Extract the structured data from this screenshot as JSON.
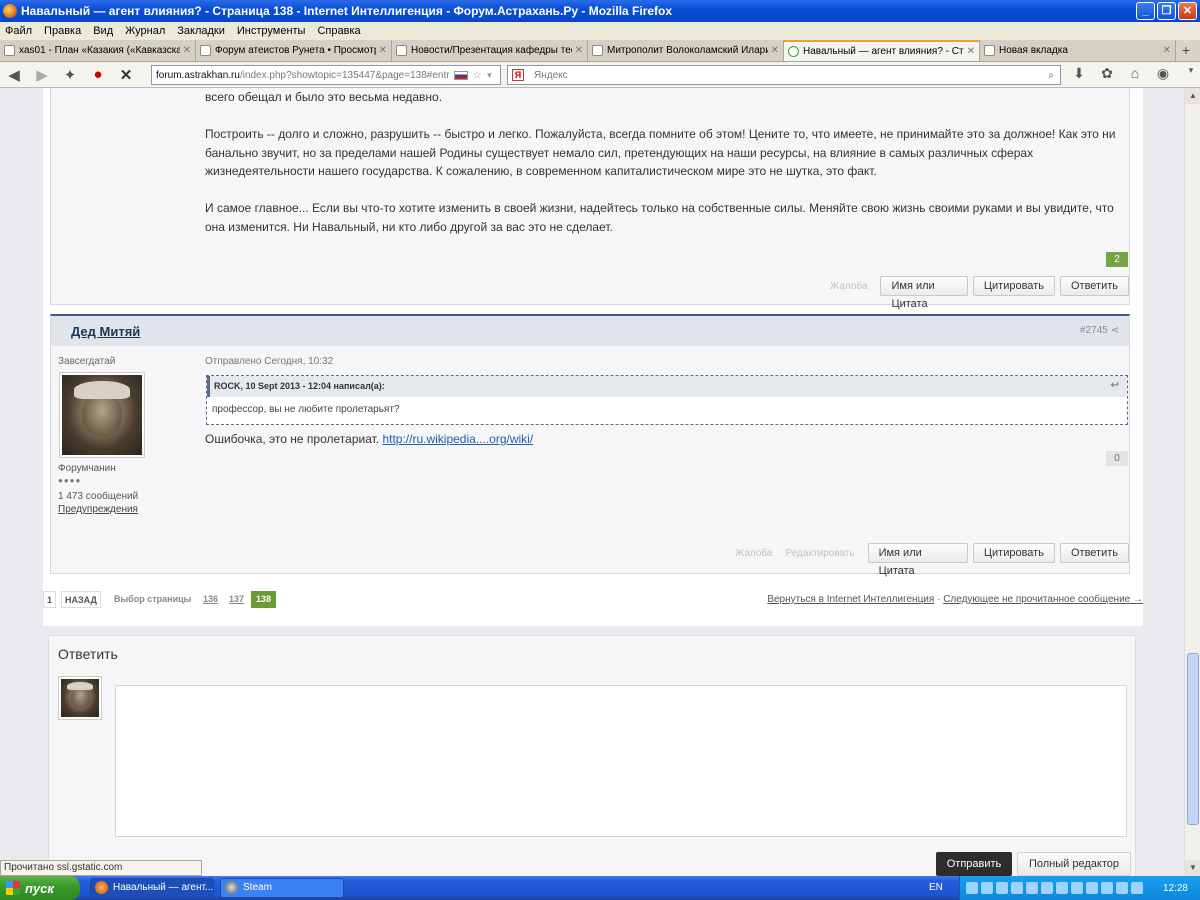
{
  "window": {
    "title": "Навальный — агент влияния? - Страница 138 - Internet Интеллигенция - Форум.Астрахань.Ру - Mozilla Firefox"
  },
  "menu": [
    "Файл",
    "Правка",
    "Вид",
    "Журнал",
    "Закладки",
    "Инструменты",
    "Справка"
  ],
  "tabs": [
    {
      "label": "xas01 - План «Казакия («Кавказска..."
    },
    {
      "label": "Форум атеистов Рунета • Просмотр ..."
    },
    {
      "label": "Новости/Презентация кафедры тео..."
    },
    {
      "label": "Митрополит Волоколамский Иларио..."
    },
    {
      "label": "Навальный — агент влияния? - Стр..."
    },
    {
      "label": "Новая вкладка"
    }
  ],
  "nav": {
    "url_host": "forum.astrakhan.ru",
    "url_path": "/index.php?showtopic=135447&page=138#entr",
    "search_placeholder": "Яндекс"
  },
  "post1": {
    "line0": "всего обещал и было это весьма недавно.",
    "para1": "Построить -- долго и сложно, разрушить -- быстро и легко. Пожалуйста, всегда помните об этом! Цените то, что имеете, не принимайте это за должное! Как это ни банально звучит, но за пределами нашей Родины существует немало сил, претендующих на наши ресурсы, на влияние в самых различных сферах жизнедеятельности нашего государства. К сожалению, в современном капиталистическом мире это не шутка, это факт.",
    "para2": "И самое главное... Если вы что-то хотите изменить в своей жизни, надейтесь только на собственные силы. Меняйте свою жизнь своими руками и вы увидите, что она изменится. Ни Навальный, ни кто либо другой за вас это не сделает.",
    "rep": "2",
    "report": "Жалоба",
    "btn_name_quote": "Имя или Цитата",
    "btn_quote": "Цитировать",
    "btn_reply": "Ответить"
  },
  "post2": {
    "author": "Дед Митяй",
    "number": "#2745",
    "group": "Завсегдатай",
    "rank": "Форумчанин",
    "rank_dots": "●●●●",
    "posts_count": "1 473 сообщений",
    "warnings": "Предупреждения",
    "posted": "Отправлено Сегодня, 10:32",
    "quote_header": "ROCK, 10 Sept 2013 - 12:04 написал(а):",
    "quote_body": "профессор, вы не любите пролетарьят?",
    "text": "Ошибочка, это не пролетариат. ",
    "link": "http://ru.wikipedia....org/wiki/",
    "rep": "0",
    "report": "Жалоба",
    "edit": "Редактировать",
    "btn_name_quote": "Имя или Цитата",
    "btn_quote": "Цитировать",
    "btn_reply": "Ответить"
  },
  "pager": {
    "first": "1",
    "back": "НАЗАД",
    "choose": "Выбор страницы",
    "p136": "136",
    "p137": "137",
    "current": "138",
    "return_link": "Вернуться в Internet Интеллигенция",
    "sep": " · ",
    "next_unread": "Следующее не прочитанное сообщение →"
  },
  "reply": {
    "title": "Ответить",
    "send": "Отправить",
    "full_editor": "Полный редактор"
  },
  "status": "Прочитано ssl.gstatic.com",
  "taskbar": {
    "start": "пуск",
    "task1": "Навальный — агент...",
    "task2": "Steam",
    "lang": "EN",
    "clock": "12:28"
  }
}
